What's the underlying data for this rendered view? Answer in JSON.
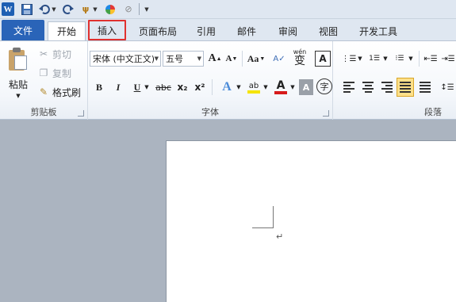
{
  "quick_access": {
    "app_logo": "W",
    "icons": [
      "word-logo",
      "save-icon",
      "undo-icon",
      "redo-icon",
      "format-painter-icon",
      "color-icon",
      "eraser-icon",
      "customize-icon"
    ]
  },
  "tabs": [
    {
      "label": "文件"
    },
    {
      "label": "开始"
    },
    {
      "label": "插入"
    },
    {
      "label": "页面布局"
    },
    {
      "label": "引用"
    },
    {
      "label": "邮件"
    },
    {
      "label": "审阅"
    },
    {
      "label": "视图"
    },
    {
      "label": "开发工具"
    }
  ],
  "active_tab": "开始",
  "highlighted_tab": "插入",
  "clipboard": {
    "group_label": "剪贴板",
    "paste": "粘贴",
    "cut": "剪切",
    "copy": "复制",
    "format_painter": "格式刷"
  },
  "font": {
    "group_label": "字体",
    "font_name": "宋体 (中文正文)",
    "font_size": "五号",
    "grow": "A",
    "shrink": "A",
    "case": "Aa",
    "phonetic": "变",
    "phonetic_top": "wén",
    "border": "A",
    "bold": "B",
    "italic": "I",
    "underline": "U",
    "strike": "abc",
    "subscript": "x₂",
    "superscript": "x²",
    "effects": "A",
    "highlight": "ab",
    "font_color": "A",
    "shading": "A",
    "enclose": "字"
  },
  "paragraph": {
    "group_label": "段落"
  },
  "colors": {
    "file_tab": "#2a64b8",
    "highlight_box": "#e0312f",
    "workspace": "#abb4c0",
    "highlight_yellow": "#f5e400",
    "font_red": "#d71b1b"
  }
}
